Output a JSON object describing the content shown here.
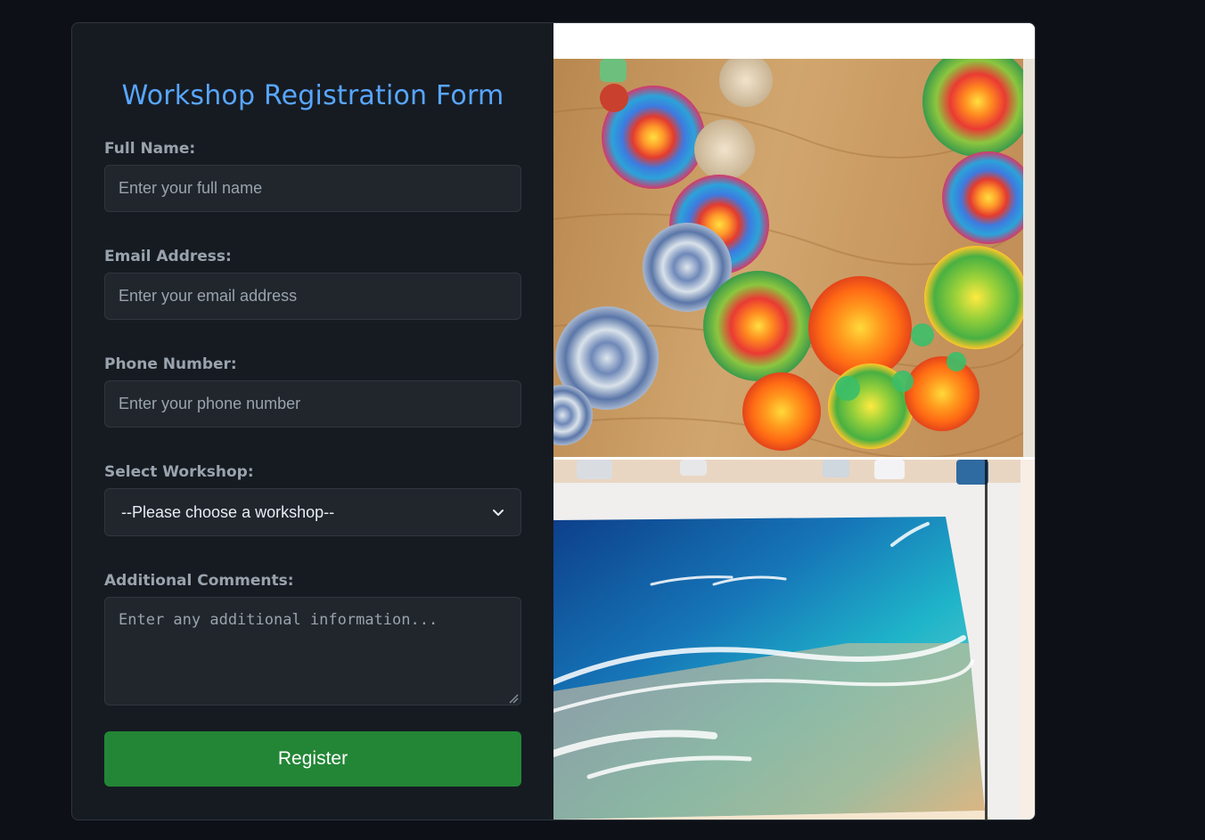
{
  "form": {
    "title": "Workshop Registration Form",
    "full_name": {
      "label": "Full Name:",
      "placeholder": "Enter your full name",
      "value": ""
    },
    "email": {
      "label": "Email Address:",
      "placeholder": "Enter your email address",
      "value": ""
    },
    "phone": {
      "label": "Phone Number:",
      "placeholder": "Enter your phone number",
      "value": ""
    },
    "workshop": {
      "label": "Select Workshop:",
      "selected": "--Please choose a workshop--"
    },
    "comments": {
      "label": "Additional Comments:",
      "placeholder": "Enter any additional information...",
      "value": ""
    },
    "submit_label": "Register"
  },
  "images": {
    "top_photo": "fabric-rope-spiral-necklace-photo",
    "bottom_photo": "resin-ocean-beach-painting-photo"
  },
  "colors": {
    "background": "#0d1117",
    "card": "#161b22",
    "accent": "#58a6ff",
    "button": "#238636",
    "input": "#21262d",
    "border": "#30363d"
  }
}
